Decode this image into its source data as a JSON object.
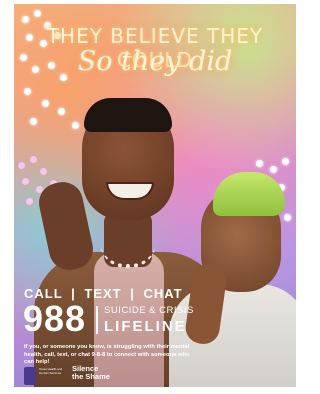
{
  "headline": {
    "line1": "THEY BELIEVE THEY COULD",
    "line2": "So they did"
  },
  "cta": {
    "call": "CALL",
    "text": "TEXT",
    "chat": "CHAT",
    "separator": "|"
  },
  "lifeline": {
    "number": "988",
    "subtitle": "SUICIDE & CRISIS",
    "title": "LIFELINE"
  },
  "body_copy": "If you, or someone you know, is struggling with their mental health, call, text, or chat 9-8-8 to connect with someone who can help!",
  "footer": {
    "seal_text": "Texas Health and Human Services",
    "logo_line1": "Silence",
    "logo_line2": "the Shame"
  },
  "colors": {
    "headline_glow": "#ff9c5a",
    "overlay_text": "#ffffff",
    "brand_accent": "#e23b8a"
  }
}
